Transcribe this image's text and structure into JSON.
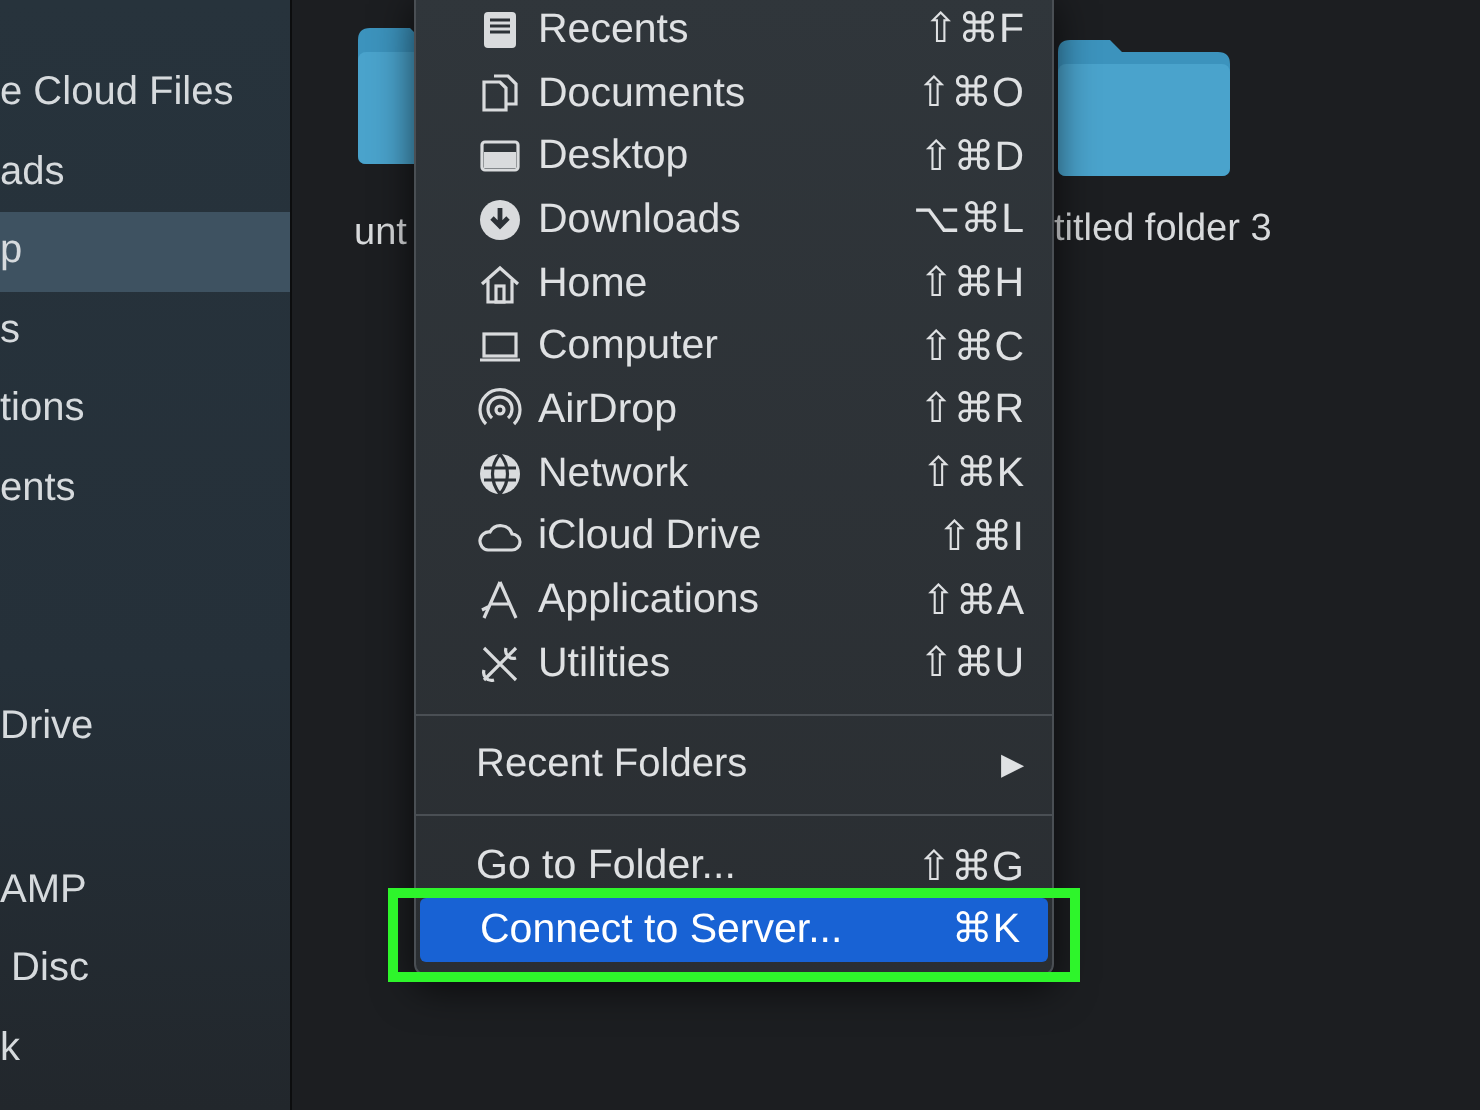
{
  "sidebar": {
    "groups": [
      [
        {
          "label": "e Cloud Files",
          "selected": false
        },
        {
          "label": "ads",
          "selected": false
        },
        {
          "label": "p",
          "selected": true
        },
        {
          "label": "s",
          "selected": false
        },
        {
          "label": "tions",
          "selected": false
        },
        {
          "label": "ents",
          "selected": false
        }
      ],
      [
        {
          "label": "Drive",
          "selected": false
        }
      ],
      [
        {
          "label": "AMP",
          "selected": false
        },
        {
          "label": " Disc",
          "selected": false
        },
        {
          "label": "k",
          "selected": false
        }
      ]
    ]
  },
  "folders": [
    {
      "name": "unt"
    },
    {
      "name": "titled folder 3"
    }
  ],
  "menu": {
    "places": [
      {
        "label": "Recents",
        "shortcut": "⇧⌘F"
      },
      {
        "label": "Documents",
        "shortcut": "⇧⌘O"
      },
      {
        "label": "Desktop",
        "shortcut": "⇧⌘D"
      },
      {
        "label": "Downloads",
        "shortcut": "⌥⌘L"
      },
      {
        "label": "Home",
        "shortcut": "⇧⌘H"
      },
      {
        "label": "Computer",
        "shortcut": "⇧⌘C"
      },
      {
        "label": "AirDrop",
        "shortcut": "⇧⌘R"
      },
      {
        "label": "Network",
        "shortcut": "⇧⌘K"
      },
      {
        "label": "iCloud Drive",
        "shortcut": "⇧⌘I"
      },
      {
        "label": "Applications",
        "shortcut": "⇧⌘A"
      },
      {
        "label": "Utilities",
        "shortcut": "⇧⌘U"
      }
    ],
    "submenu": {
      "label": "Recent Folders",
      "arrow": "▶"
    },
    "actions": [
      {
        "label": "Go to Folder...",
        "shortcut": "⇧⌘G",
        "selected": false
      },
      {
        "label": "Connect to Server...",
        "shortcut": "⌘K",
        "selected": true
      }
    ]
  }
}
